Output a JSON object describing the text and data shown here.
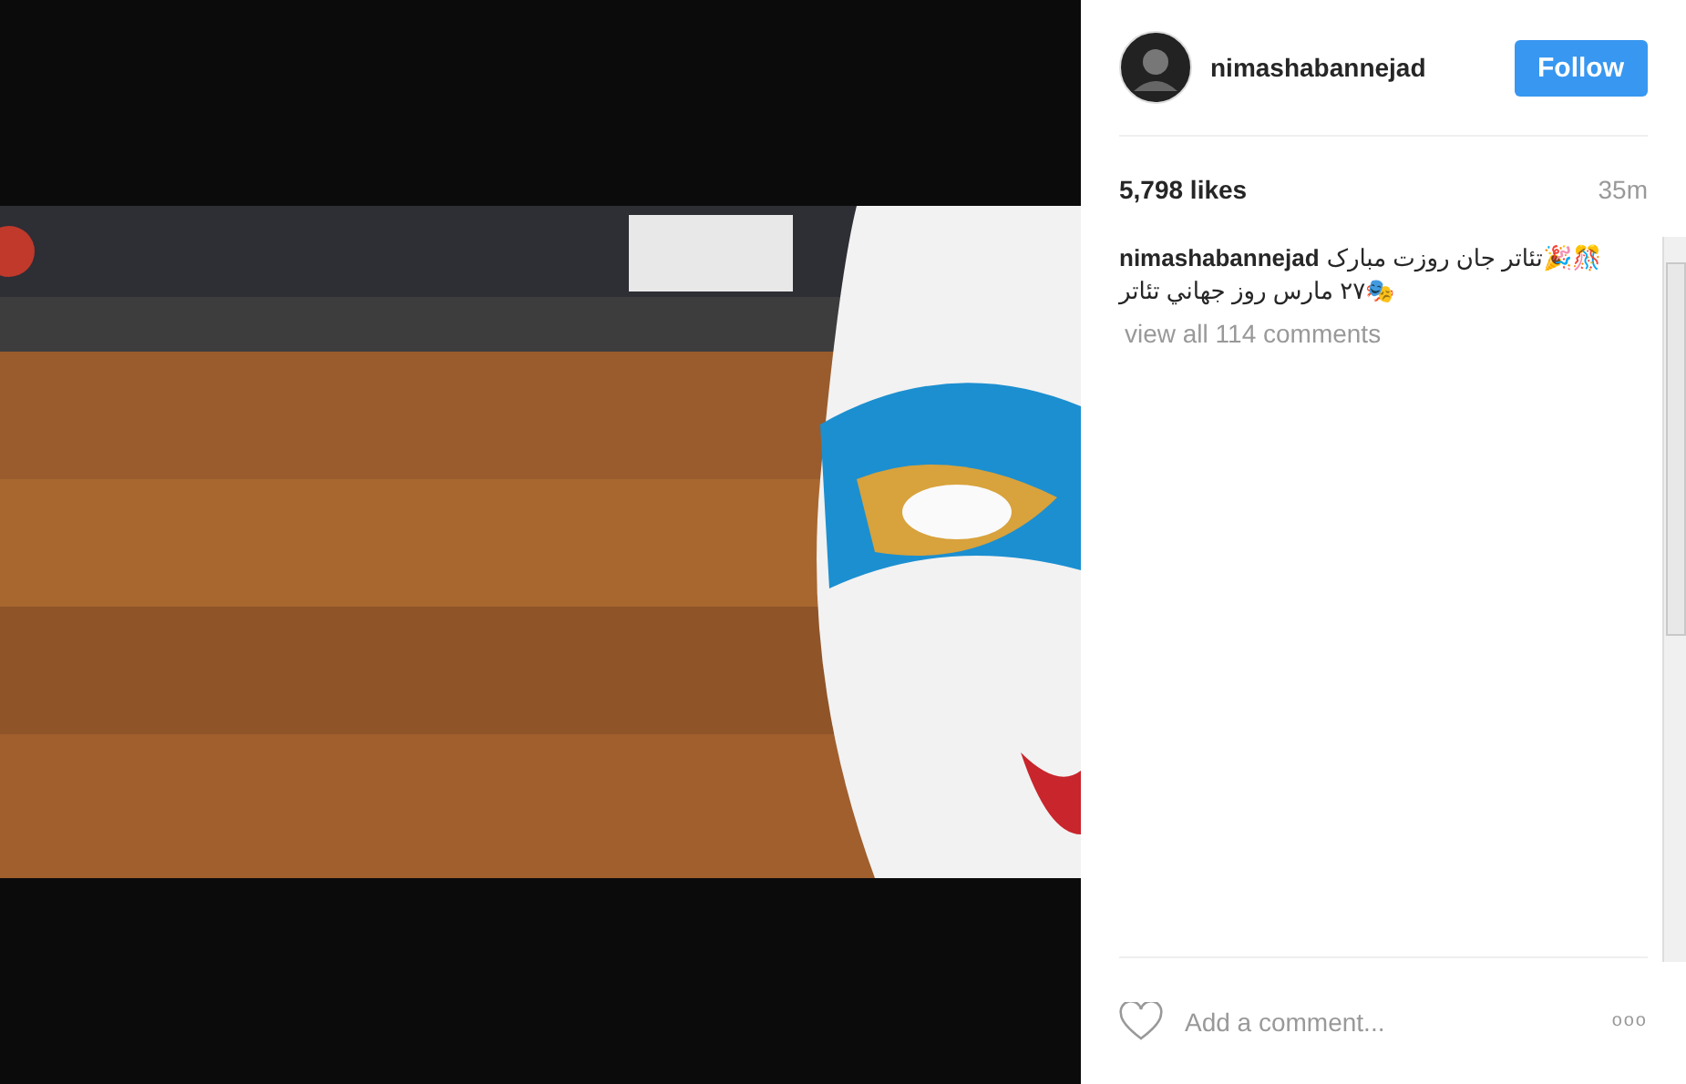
{
  "post": {
    "author": {
      "username": "nimashabannejad",
      "follow_button": "Follow"
    },
    "likes": "5,798 likes",
    "time": "35m",
    "caption": {
      "username": "nimashabannejad",
      "lines": [
        "تئاتر جان روزت مبارک🎉🎊",
        "🎭۲۷ مارس روز جهاني تئاتر"
      ]
    },
    "view_comments": "view all 114 comments",
    "comment_field": {
      "placeholder": "Add a comment..."
    },
    "more_button": "ooo"
  }
}
